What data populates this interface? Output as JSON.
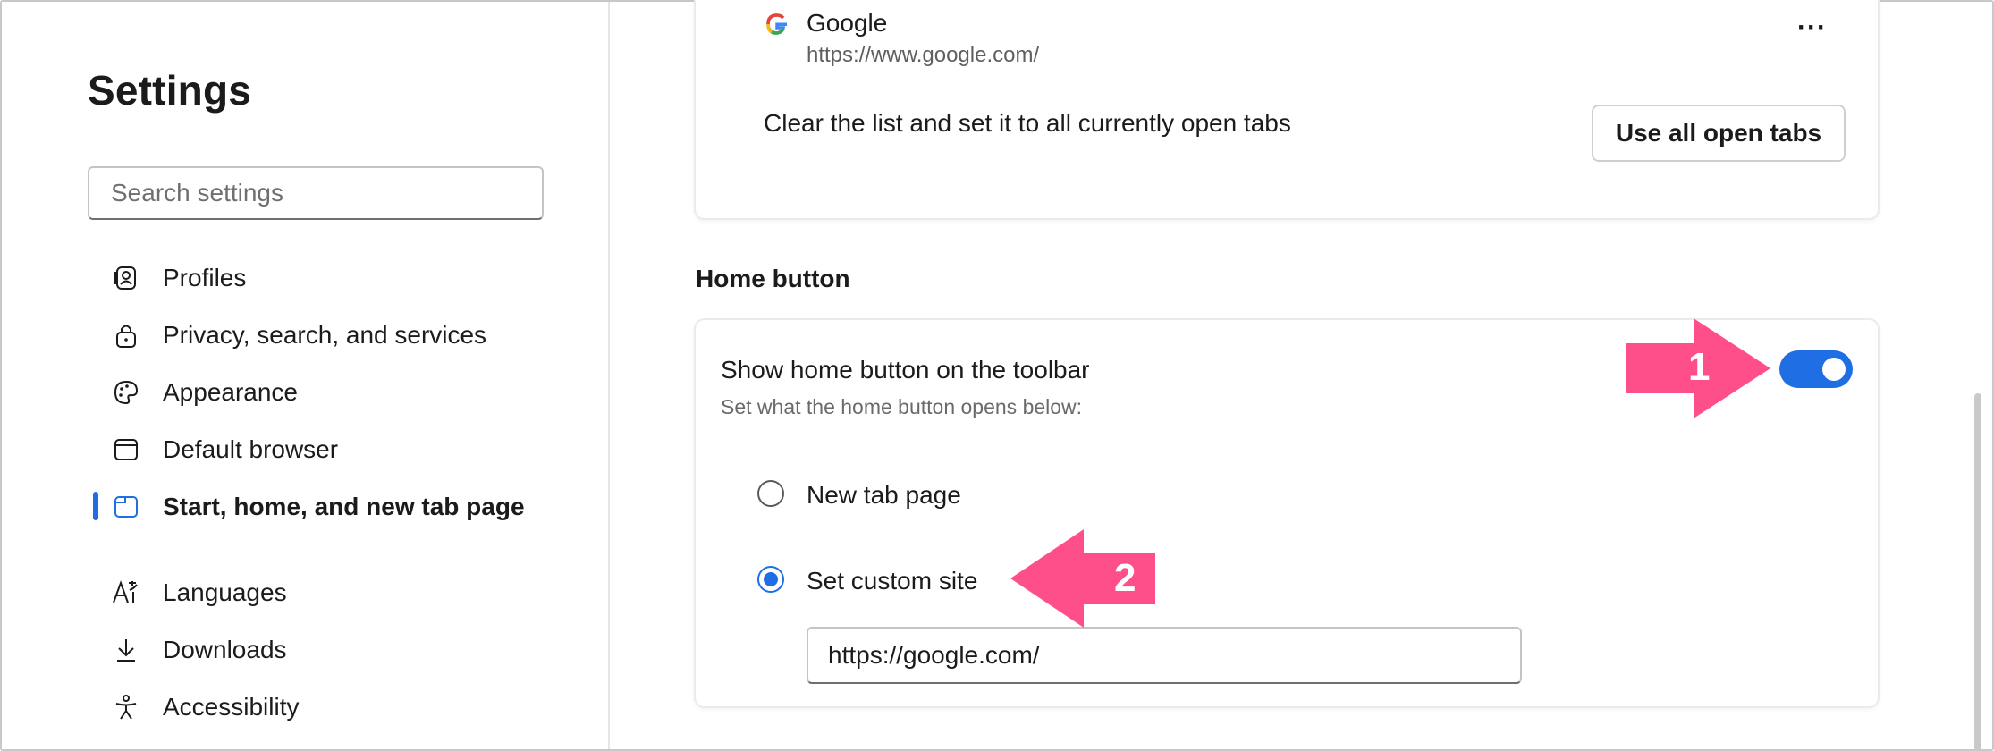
{
  "sidebar": {
    "title": "Settings",
    "search_placeholder": "Search settings",
    "items": [
      {
        "label": "Profiles",
        "icon": "profile-icon"
      },
      {
        "label": "Privacy, search, and services",
        "icon": "lock-icon"
      },
      {
        "label": "Appearance",
        "icon": "palette-icon"
      },
      {
        "label": "Default browser",
        "icon": "browser-icon"
      },
      {
        "label": "Start, home, and new tab page",
        "icon": "start-page-icon",
        "active": true
      },
      {
        "label": "Languages",
        "icon": "languages-icon"
      },
      {
        "label": "Downloads",
        "icon": "download-icon"
      },
      {
        "label": "Accessibility",
        "icon": "accessibility-icon"
      }
    ]
  },
  "startup_card": {
    "site_name": "Google",
    "site_url": "https://www.google.com/",
    "more_label": "···",
    "clear_text": "Clear the list and set it to all currently open tabs",
    "use_tabs_button": "Use all open tabs"
  },
  "home_button": {
    "section_title": "Home button",
    "show_label": "Show home button on the toolbar",
    "show_sublabel": "Set what the home button opens below:",
    "toggle_on": true,
    "options": [
      {
        "label": "New tab page",
        "selected": false
      },
      {
        "label": "Set custom site",
        "selected": true
      }
    ],
    "custom_url": "https://google.com/"
  },
  "annotations": [
    {
      "label": "1"
    },
    {
      "label": "2"
    }
  ],
  "colors": {
    "accent": "#1f6ee3",
    "annotation": "#ff4f8b"
  }
}
